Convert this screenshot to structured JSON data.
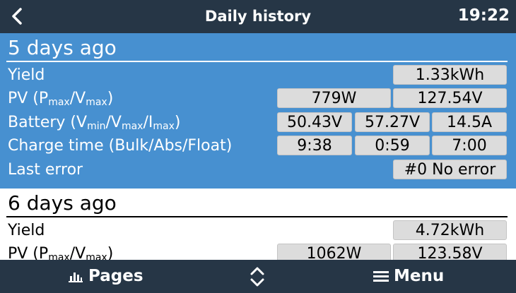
{
  "header": {
    "title": "Daily history",
    "time": "19:22"
  },
  "days": [
    {
      "title": "5 days ago",
      "yield": "1.33kWh",
      "pv": [
        "779W",
        "127.54V"
      ],
      "battery": [
        "50.43V",
        "57.27V",
        "14.5A"
      ],
      "charge_time": [
        "9:38",
        "0:59",
        "7:00"
      ],
      "last_error": "#0 No error"
    },
    {
      "title": "6 days ago",
      "yield": "4.72kWh",
      "pv": [
        "1062W",
        "123.58V"
      ]
    }
  ],
  "labels": {
    "yield": "Yield",
    "pv": {
      "text": "PV (",
      "p": "P",
      "max": "max",
      "slash": "/",
      "v": "V",
      "close": ")"
    },
    "battery": {
      "text": "Battery (",
      "v": "V",
      "min": "min",
      "slash": "/",
      "max": "max",
      "i": "I",
      "close": ")"
    },
    "charge_time": "Charge time (Bulk/Abs/Float)",
    "last_error": "Last error"
  },
  "footer": {
    "pages_label": "Pages",
    "menu_label": "Menu"
  },
  "icons": {
    "back": "chevron-left-icon",
    "pages": "bar-chart-icon",
    "updown": "up-down-chevron-icon",
    "menu": "hamburger-icon"
  },
  "colors": {
    "bar": "#263646",
    "selected": "#4790d0",
    "value_box": "#dcdcdc"
  }
}
